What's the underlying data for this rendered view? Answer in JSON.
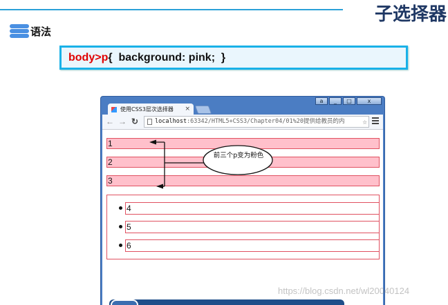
{
  "slide": {
    "title": "子选择器",
    "section_label": "语法",
    "code": {
      "selector": "body>p",
      "rest": "{  background: pink;  }"
    }
  },
  "browser": {
    "tab_title": "使用CSS3层次选择器",
    "tab_close": "×",
    "window_controls": [
      "a",
      "_",
      "□",
      "x"
    ],
    "url_host": "localhost",
    "url_rest": ":63342/HTML5+CSS3/Chapter04/01%20提供给教员的内",
    "icons": [
      "back-arrow-icon",
      "forward-arrow-icon",
      "reload-icon",
      "page-icon",
      "star-icon",
      "menu-icon"
    ]
  },
  "page": {
    "paragraphs": [
      "1",
      "2",
      "3"
    ],
    "list_items": [
      "4",
      "5",
      "6"
    ],
    "annotation": "前三个p变为粉色",
    "pink": "#ffc0cb",
    "border": "#e05060"
  },
  "watermark": "https://blog.csdn.net/wl20040124"
}
